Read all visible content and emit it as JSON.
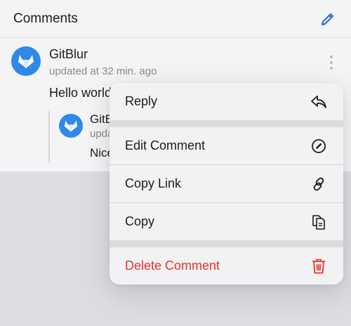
{
  "card": {
    "title": "Comments",
    "edit_icon": "pencil-icon"
  },
  "comment": {
    "author": "GitBlur",
    "meta": "updated at 32 min. ago",
    "body": "Hello world",
    "reply": {
      "author": "GitBlur",
      "meta": "updated",
      "body": "Nice"
    }
  },
  "menu": {
    "items": [
      {
        "label": "Reply",
        "icon": "reply-arrow-icon"
      },
      {
        "label": "Edit Comment",
        "icon": "edit-circle-icon"
      },
      {
        "label": "Copy Link",
        "icon": "link-icon"
      },
      {
        "label": "Copy",
        "icon": "copy-document-icon"
      },
      {
        "label": "Delete Comment",
        "icon": "trash-icon"
      }
    ]
  },
  "colors": {
    "accent": "#2f6fd6",
    "avatar": "#2f89e8",
    "destructive": "#e5332a"
  }
}
